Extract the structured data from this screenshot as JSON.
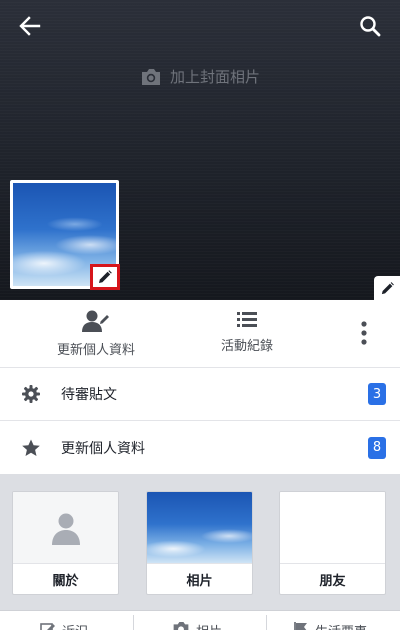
{
  "cover": {
    "add_cover_label": "加上封面相片",
    "icons": [
      "back-arrow-icon",
      "search-icon",
      "camera-icon",
      "pencil-icon"
    ]
  },
  "actions": {
    "update_profile": "更新個人資料",
    "activity_log": "活動紀錄",
    "icons": [
      "person-edit-icon",
      "list-icon",
      "more-vertical-icon"
    ]
  },
  "list": {
    "pending_posts": {
      "label": "待審貼文",
      "count": "3",
      "icon": "gear-icon"
    },
    "update_profile": {
      "label": "更新個人資料",
      "count": "8",
      "icon": "star-icon"
    }
  },
  "cards": {
    "about": "關於",
    "photos": "相片",
    "friends": "朋友"
  },
  "bottom_tabs": {
    "status": "近況",
    "photo": "相片",
    "life_event": "生活要事"
  },
  "colors": {
    "badge": "#2a70e6",
    "highlight_box": "#d6151b",
    "cover_bg": "#23272f",
    "content_gray": "#dcdee3"
  }
}
